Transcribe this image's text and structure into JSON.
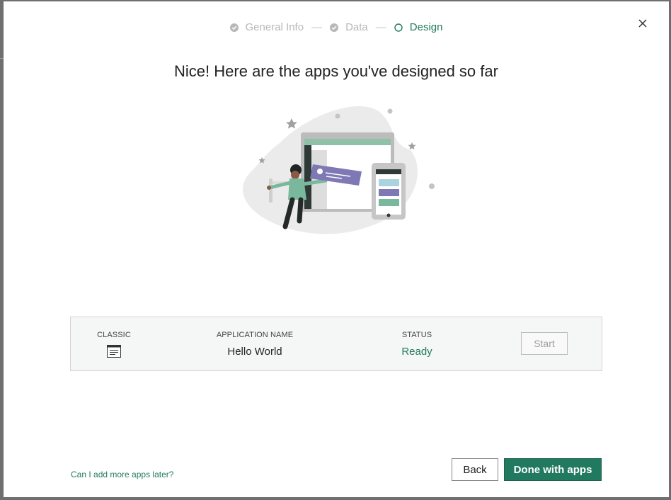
{
  "stepper": {
    "steps": [
      {
        "label": "General Info",
        "state": "complete"
      },
      {
        "label": "Data",
        "state": "complete"
      },
      {
        "label": "Design",
        "state": "active"
      }
    ],
    "separator": "—"
  },
  "title": "Nice! Here are the apps you've designed so far",
  "apps_table": {
    "headers": {
      "classic": "CLASSIC",
      "name": "APPLICATION NAME",
      "status": "STATUS"
    },
    "rows": [
      {
        "classic_icon": "classic-app-icon",
        "name": "Hello World",
        "status": "Ready",
        "action_label": "Start"
      }
    ]
  },
  "footer": {
    "help_link": "Can I add more apps later?",
    "back_label": "Back",
    "done_label": "Done with apps"
  },
  "colors": {
    "accent": "#217a5f",
    "illustration_green": "#8fc1a8",
    "illustration_purple": "#7e78b4",
    "illustration_blue": "#a9d4de"
  },
  "icons": {
    "close": "close-icon",
    "complete": "check-circle-icon",
    "active": "empty-circle-icon"
  }
}
